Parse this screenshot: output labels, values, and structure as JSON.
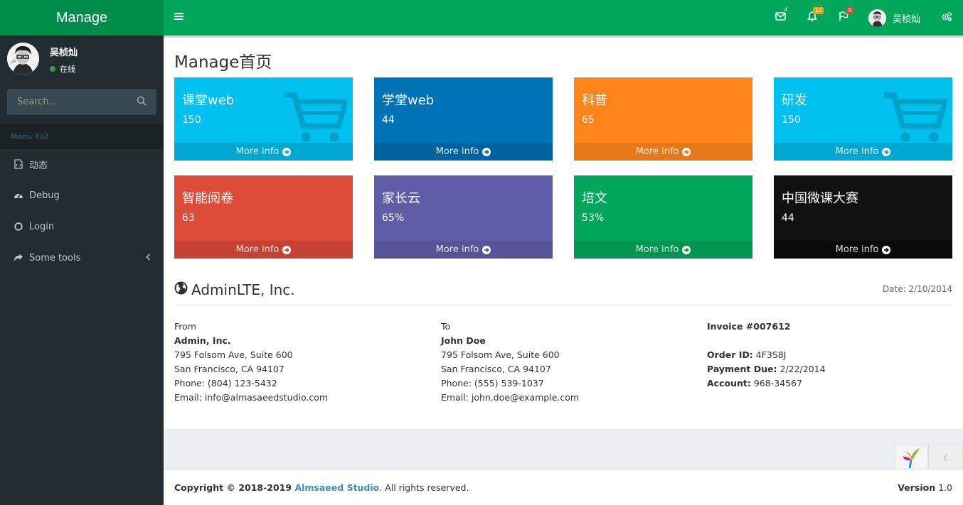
{
  "header": {
    "logo": "Manage",
    "user_name": "吴桢灿",
    "badges": {
      "messages": "4",
      "notifications": "10",
      "tasks": "9"
    },
    "colors": {
      "logo_bg": "#008d4c",
      "bar_bg": "#00a65a",
      "msg_badge": "#00a65a",
      "notif_badge": "#f39c12",
      "task_badge": "#dd4b39"
    }
  },
  "sidebar": {
    "user_name": "吴桢灿",
    "status": "在线",
    "search_placeholder": "Search...",
    "menu_header": "Menu Yii2",
    "items": [
      {
        "label": "动态",
        "icon": "file-code-icon"
      },
      {
        "label": "Debug",
        "icon": "dashboard-icon"
      },
      {
        "label": "Login",
        "icon": "circle-icon"
      },
      {
        "label": "Some tools",
        "icon": "share-icon"
      }
    ]
  },
  "page": {
    "title": "Manage首页"
  },
  "boxes": [
    {
      "title": "课堂web",
      "value": "150",
      "more": "More info",
      "color": "#00c0ef",
      "icon": "shopping-cart-icon"
    },
    {
      "title": "学堂web",
      "value": "44",
      "more": "More info",
      "color": "#0073b7"
    },
    {
      "title": "科普",
      "value": "65",
      "more": "More info",
      "color": "#ff851b"
    },
    {
      "title": "研发",
      "value": "150",
      "more": "More info",
      "color": "#00c0ef",
      "icon": "shopping-cart-icon"
    },
    {
      "title": "智能阅卷",
      "value": "63",
      "more": "More info",
      "color": "#dd4b39"
    },
    {
      "title": "家长云",
      "value": "65%",
      "more": "More info",
      "color": "#605ca8"
    },
    {
      "title": "培文",
      "value": "53%",
      "more": "More info",
      "color": "#00a65a"
    },
    {
      "title": "中国微课大赛",
      "value": "44",
      "more": "More info",
      "color": "#111111"
    }
  ],
  "invoice": {
    "company": "AdminLTE, Inc.",
    "date": "Date: 2/10/2014",
    "from": {
      "label": "From",
      "name": "Admin, Inc.",
      "address1": "795 Folsom Ave, Suite 600",
      "address2": "San Francisco, CA 94107",
      "phone": "Phone: (804) 123-5432",
      "email": "Email: info@almasaeedstudio.com"
    },
    "to": {
      "label": "To",
      "name": "John Doe",
      "address1": "795 Folsom Ave, Suite 600",
      "address2": "San Francisco, CA 94107",
      "phone": "Phone: (555) 539-1037",
      "email": "Email: john.doe@example.com"
    },
    "meta": {
      "invoice_no": "Invoice #007612",
      "order_label": "Order ID:",
      "order_value": " 4F3S8J",
      "due_label": "Payment Due:",
      "due_value": " 2/22/2014",
      "account_label": "Account:",
      "account_value": " 968-34567"
    }
  },
  "footer": {
    "copyright": "Copyright © 2018-2019 ",
    "company_link": "Almsaeed Studio",
    "rights": ". All rights reserved.",
    "version_label": "Version",
    "version_value": " 1.0"
  }
}
